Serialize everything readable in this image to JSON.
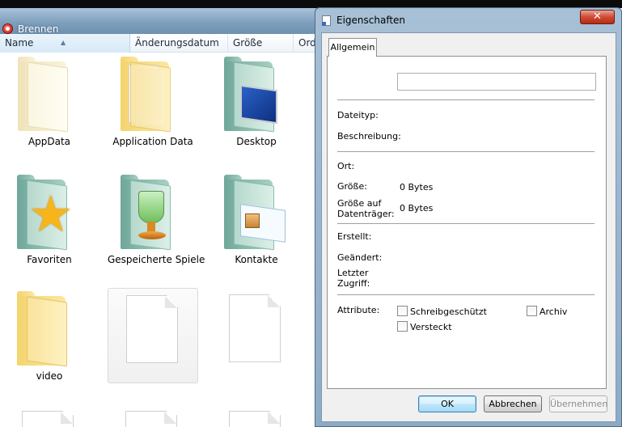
{
  "explorer": {
    "title": "Brennen",
    "columns": [
      "Name",
      "Änderungsdatum",
      "Größe",
      "Ord"
    ],
    "items": [
      {
        "label": "AppData",
        "icon": "folder-icon"
      },
      {
        "label": "Application Data",
        "icon": "folder-with-documents-icon"
      },
      {
        "label": "Desktop",
        "icon": "desktop-folder-icon"
      },
      {
        "label": "Favoriten",
        "icon": "favorites-star-folder-icon"
      },
      {
        "label": "Gespeicherte Spiele",
        "icon": "saved-games-folder-icon"
      },
      {
        "label": "Kontakte",
        "icon": "contacts-folder-icon"
      },
      {
        "label": "video",
        "icon": "folder-icon"
      },
      {
        "label": "",
        "icon": "blank-file-icon"
      },
      {
        "label": "",
        "icon": "blank-file-icon"
      }
    ]
  },
  "dialog": {
    "title": "Eigenschaften",
    "close_label": "✕",
    "tab": "Allgemein",
    "name_value": "",
    "labels": {
      "dateityp": "Dateityp:",
      "beschreibung": "Beschreibung:",
      "ort": "Ort:",
      "groesse": "Größe:",
      "groesse_auf_1": "Größe auf",
      "groesse_auf_2": "Datenträger:",
      "erstellt": "Erstellt:",
      "geaendert": "Geändert:",
      "letzter_1": "Letzter",
      "letzter_2": "Zugriff:",
      "attribute": "Attribute:"
    },
    "values": {
      "groesse": "0 Bytes",
      "groesse_auf": "0 Bytes"
    },
    "attributes": {
      "schreibgeschuetzt": "Schreibgeschützt",
      "versteckt": "Versteckt",
      "archiv": "Archiv"
    },
    "buttons": {
      "ok": "OK",
      "abbrechen": "Abbrechen",
      "uebernehmen": "Übernehmen"
    }
  }
}
